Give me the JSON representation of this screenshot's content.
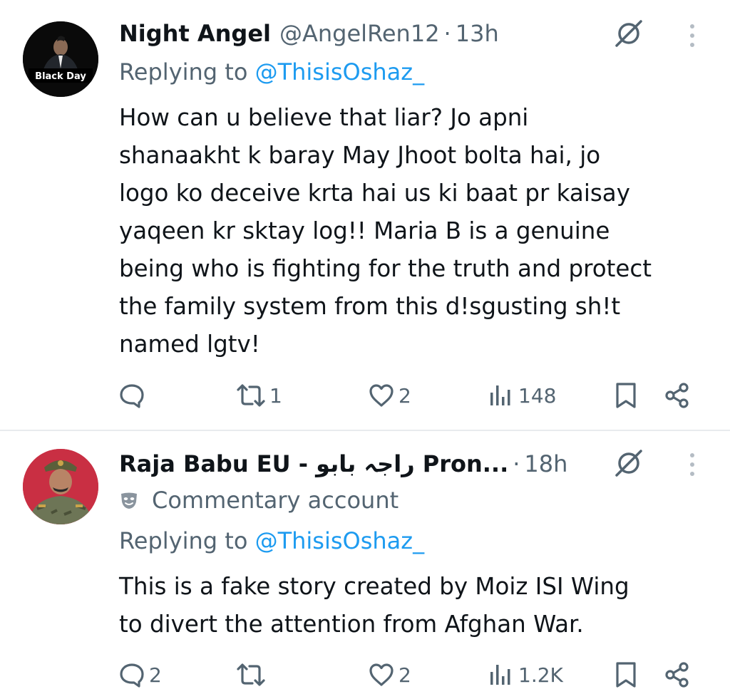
{
  "tweets": [
    {
      "author_name": "Night Angel",
      "handle": "@AngelRen12",
      "separator": "·",
      "time": "13h",
      "avatar_caption": "Black Day",
      "replying_prefix": "Replying to",
      "replying_to": "@ThisisOshaz_",
      "body_lines": [
        "How can u believe that liar? Jo apni",
        "shanaakht k baray May Jhoot bolta hai, jo",
        "logo ko deceive krta hai us ki baat pr kaisay",
        "yaqeen kr sktay log!! Maria B is a genuine",
        "being who is fighting for the truth and protect",
        "the family system from this d!sgusting sh!t",
        "named lgtv!"
      ],
      "replies": "",
      "reposts": "1",
      "likes": "2",
      "views": "148"
    },
    {
      "author_name": "Raja Babu EU - راجہ بابو Pron...",
      "handle": "",
      "separator": "·",
      "time": "18h",
      "commentary_label": "Commentary account",
      "replying_prefix": "Replying to",
      "replying_to": "@ThisisOshaz_",
      "body_lines": [
        "This is a fake story created by Moiz ISI Wing",
        "to divert the attention from Afghan War."
      ],
      "replies": "2",
      "reposts": "",
      "likes": "2",
      "views": "1.2K"
    }
  ],
  "icons": {
    "reply": "reply-icon",
    "repost": "repost-icon",
    "like": "heart-icon",
    "views": "views-icon",
    "bookmark": "bookmark-icon",
    "share": "share-icon",
    "grok": "grok-icon",
    "more": "more-vertical-icon",
    "commentary": "mask-icon"
  },
  "colors": {
    "text": "#0f1419",
    "secondary": "#536471",
    "link": "#1d9bf0",
    "divider": "#e8ebee"
  }
}
